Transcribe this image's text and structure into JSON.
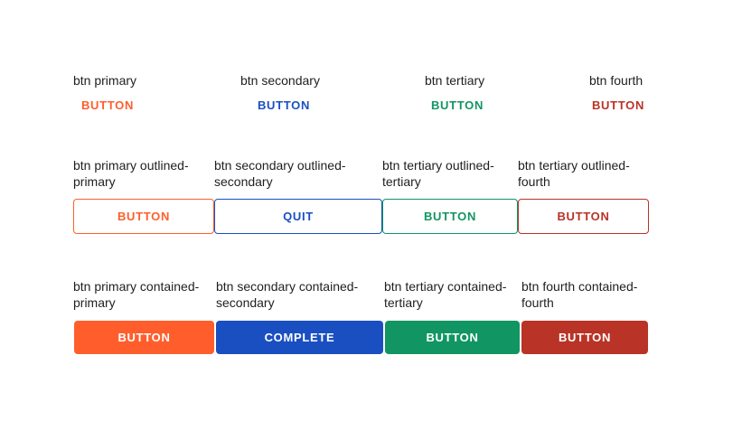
{
  "colors": {
    "primary": "#ff5e2c",
    "secondary": "#1a4fc2",
    "tertiary": "#119563",
    "fourth": "#b93326"
  },
  "text_row": {
    "primary": {
      "label": "btn primary",
      "button": "BUTTON"
    },
    "secondary": {
      "label": "btn secondary",
      "button": "BUTTON"
    },
    "tertiary": {
      "label": "btn tertiary",
      "button": "BUTTON"
    },
    "fourth": {
      "label": "btn fourth",
      "button": "BUTTON"
    }
  },
  "outlined_row": {
    "primary": {
      "label_1": "btn primary outlined-",
      "label_2": "primary",
      "button": "BUTTON"
    },
    "secondary": {
      "label_1": "btn secondary outlined-",
      "label_2": "secondary",
      "button": "QUIT"
    },
    "tertiary": {
      "label_1": "btn tertiary outlined-",
      "label_2": "tertiary",
      "button": "BUTTON"
    },
    "fourth": {
      "label_1": "btn tertiary outlined-",
      "label_2": "fourth",
      "button": "BUTTON"
    }
  },
  "contained_row": {
    "primary": {
      "label_1": "btn primary contained-",
      "label_2": "primary",
      "button": "BUTTON"
    },
    "secondary": {
      "label_1": "btn secondary contained-",
      "label_2": "secondary",
      "button": "COMPLETE"
    },
    "tertiary": {
      "label_1": "btn tertiary contained-",
      "label_2": "tertiary",
      "button": "BUTTON"
    },
    "fourth": {
      "label_1": "btn fourth contained-",
      "label_2": "fourth",
      "button": "BUTTON"
    }
  }
}
